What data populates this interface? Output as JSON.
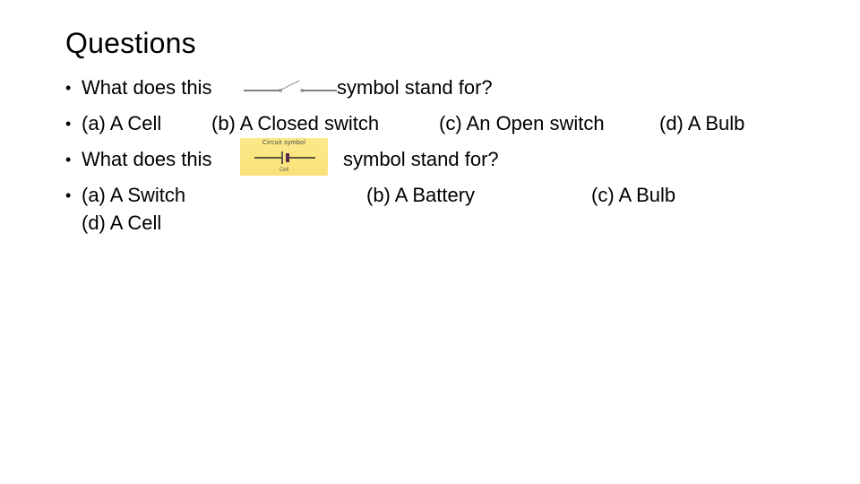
{
  "slide": {
    "title": "Questions",
    "bullet_glyph": "•",
    "q1": {
      "prefix": "What does this",
      "symbol_icon": "open-switch-symbol",
      "suffix": "symbol stand for?",
      "options": {
        "a": "(a) A Cell",
        "b": "(b) A Closed switch",
        "c": "(c) An Open switch",
        "d": "(d) A Bulb"
      }
    },
    "q2": {
      "prefix": "What does this",
      "symbol_icon": "cell-symbol",
      "symbol_caption_top": "Circuit symbol",
      "symbol_caption_bottom": "Cell",
      "suffix": "symbol stand for?",
      "options": {
        "a": "(a) A Switch",
        "b": "(b) A Battery",
        "c": "(c) A Bulb",
        "d": "(d) A Cell"
      }
    },
    "colors": {
      "text": "#000000",
      "background": "#ffffff",
      "symbol_card": "#fae27a",
      "cell_plate": "#5a2a4a"
    }
  }
}
